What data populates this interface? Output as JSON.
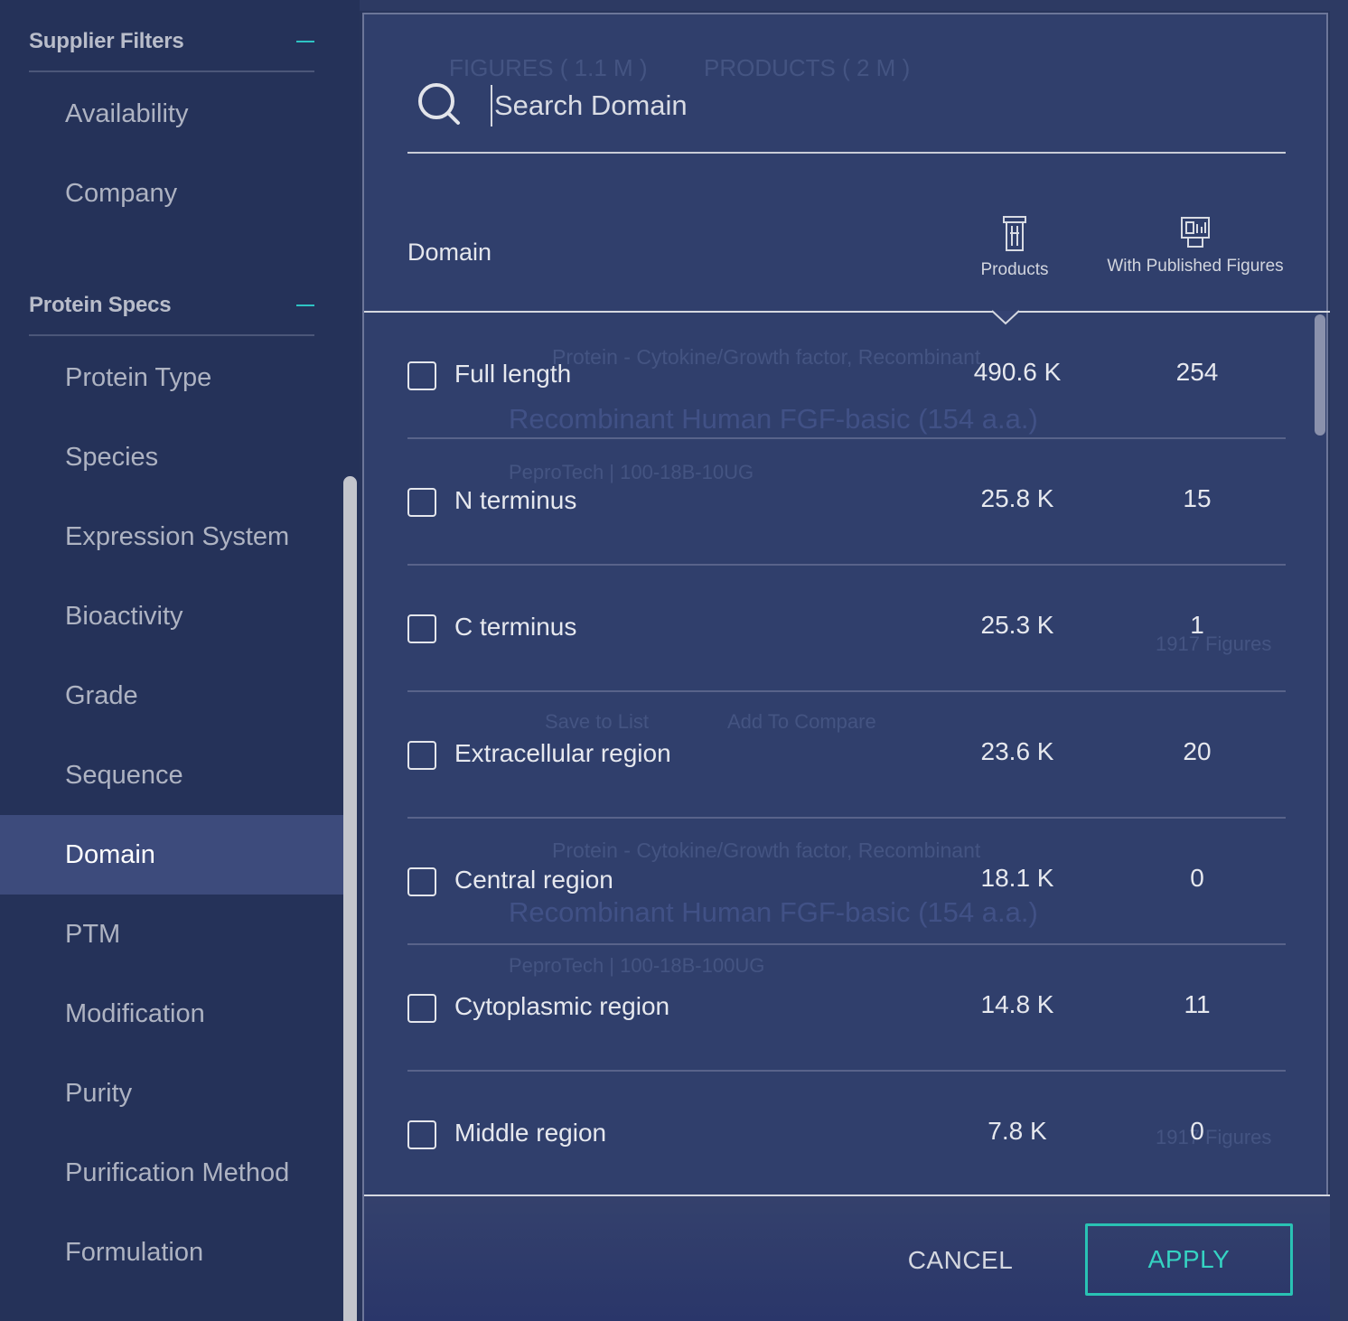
{
  "sidebar": {
    "sections": [
      {
        "title": "Supplier Filters",
        "items": [
          "Availability",
          "Company"
        ]
      },
      {
        "title": "Protein Specs",
        "items": [
          "Protein Type",
          "Species",
          "Expression System",
          "Bioactivity",
          "Grade",
          "Sequence",
          "Domain",
          "PTM",
          "Modification",
          "Purity",
          "Purification Method",
          "Formulation"
        ]
      }
    ],
    "active_item": "Domain"
  },
  "background": {
    "tabs": [
      "FIGURES ( 1.1 M )",
      "PRODUCTS ( 2 M )"
    ],
    "product_type": "Protein - Cytokine/Growth factor, Recombinant",
    "product_name": "Recombinant Human FGF-basic (154 a.a.)",
    "supplier_1": "PeproTech | 100-18B-10UG",
    "supplier_2": "PeproTech | 100-18B-100UG",
    "figures_count": "1917 Figures",
    "save_label": "Save to List",
    "compare_label": "Add To Compare"
  },
  "modal": {
    "search": {
      "placeholder": "Search Domain"
    },
    "columns": {
      "domain": "Domain",
      "products": "Products",
      "figures": "With Published Figures"
    },
    "rows": [
      {
        "label": "Full length",
        "products": "490.6 K",
        "figures": "254"
      },
      {
        "label": "N terminus",
        "products": "25.8 K",
        "figures": "15"
      },
      {
        "label": "C terminus",
        "products": "25.3 K",
        "figures": "1"
      },
      {
        "label": "Extracellular region",
        "products": "23.6 K",
        "figures": "20"
      },
      {
        "label": "Central region",
        "products": "18.1 K",
        "figures": "0"
      },
      {
        "label": "Cytoplasmic region",
        "products": "14.8 K",
        "figures": "11"
      },
      {
        "label": "Middle region",
        "products": "7.8 K",
        "figures": "0"
      }
    ],
    "cancel_label": "CANCEL",
    "apply_label": "APPLY"
  },
  "colors": {
    "accent": "#2ec4c4",
    "sidebar_bg": "#253259",
    "active_bg": "#3d4b7c",
    "modal_bg": "#32406e"
  }
}
